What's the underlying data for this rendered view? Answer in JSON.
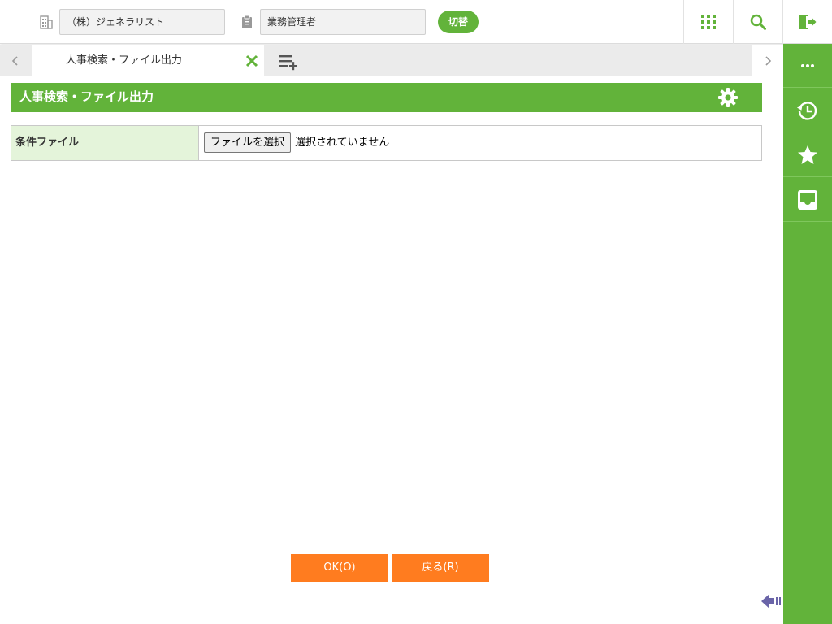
{
  "header": {
    "company_value": "（株）ジェネラリスト",
    "role_value": "業務管理者",
    "switch_label": "切替",
    "icons": [
      "building-icon",
      "clipboard-icon",
      "grid-menu-icon",
      "search-icon",
      "logout-icon"
    ]
  },
  "tabs": {
    "items": [
      {
        "label": "人事検索・ファイル出力",
        "active": true
      }
    ],
    "icons": [
      "chevron-left-icon",
      "close-icon",
      "add-list-icon",
      "chevron-right-icon"
    ]
  },
  "sidebar": {
    "items": [
      "more-icon",
      "history-icon",
      "star-icon",
      "inbox-icon"
    ]
  },
  "page": {
    "title": "人事検索・ファイル出力",
    "form": {
      "condition_file_label": "条件ファイル",
      "file_button_label": "ファイルを選択",
      "file_status": "選択されていません"
    },
    "buttons": {
      "ok_label": "OK(O)",
      "back_label": "戻る(R)"
    }
  },
  "colors": {
    "accent_green": "#62b33a",
    "action_orange": "#ff7c1f",
    "label_bg": "#e4f4da"
  }
}
